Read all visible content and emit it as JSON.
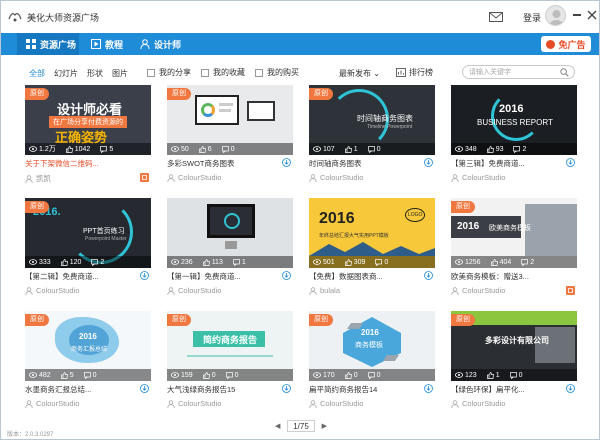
{
  "app": {
    "title": "美化大师资源广场",
    "login_label": "登录",
    "version": "版本：2.0.3.0297"
  },
  "nav": {
    "tabs": [
      {
        "label": "资源广场",
        "icon": "grid-icon"
      },
      {
        "label": "教程",
        "icon": "play-icon"
      },
      {
        "label": "设计师",
        "icon": "user-icon"
      }
    ],
    "ad_label": "免广告"
  },
  "filters": {
    "tabs": [
      "全部",
      "幻灯片",
      "形状",
      "图片"
    ],
    "checks": [
      "我的分享",
      "我的收藏",
      "我的购买"
    ],
    "sort_label": "最新发布 ⌄",
    "rank_label": "排行榜",
    "search_placeholder": "请输入关键字"
  },
  "cards": [
    {
      "title": "关于下架微信二维码...",
      "author": "凯凯",
      "views": "1.2万",
      "likes": "1042",
      "comments": "5",
      "original": true,
      "promo": true
    },
    {
      "title": "多彩SWOT商务图表",
      "author": "ColourStudio",
      "views": "50",
      "likes": "6",
      "comments": "0",
      "original": true,
      "promo": false
    },
    {
      "title": "时间轴商务图表",
      "author": "ColourStudio",
      "views": "107",
      "likes": "1",
      "comments": "0",
      "original": true,
      "promo": false
    },
    {
      "title": "【第三辑】免费商道...",
      "author": "ColourStudio",
      "views": "348",
      "likes": "93",
      "comments": "2",
      "original": false,
      "promo": false
    },
    {
      "title": "【第二辑】免费商道...",
      "author": "ColourStudio",
      "views": "333",
      "likes": "120",
      "comments": "2",
      "original": true,
      "promo": false
    },
    {
      "title": "【第一辑】免费商道...",
      "author": "ColourStudio",
      "views": "236",
      "likes": "113",
      "comments": "1",
      "original": false,
      "promo": false
    },
    {
      "title": "【免费】数据图表商...",
      "author": "bulala",
      "views": "501",
      "likes": "309",
      "comments": "0",
      "original": false,
      "promo": false
    },
    {
      "title": "欧美商务模板：赠送3...",
      "author": "ColourStudio",
      "views": "1256",
      "likes": "404",
      "comments": "2",
      "original": true,
      "promo": false
    },
    {
      "title": "水墨商务汇报总结...",
      "author": "ColourStudio",
      "views": "482",
      "likes": "5",
      "comments": "0",
      "original": true,
      "promo": false
    },
    {
      "title": "大气浅绿商务报告15",
      "author": "ColourStudio",
      "views": "159",
      "likes": "0",
      "comments": "0",
      "original": true,
      "promo": false
    },
    {
      "title": "扁平简约商务报告14",
      "author": "ColourStudio",
      "views": "170",
      "likes": "0",
      "comments": "0",
      "original": true,
      "promo": false
    },
    {
      "title": "【绿色环保】扁平化...",
      "author": "ColourStudio",
      "views": "123",
      "likes": "1",
      "comments": "0",
      "original": true,
      "promo": false
    }
  ],
  "thumb_text": {
    "c0_line1": "设计师必看",
    "c0_line2": "在广场分享付费资源的",
    "c0_line3": "正确姿势",
    "c2_line1": "时间轴商务图表",
    "c2_line2": "Timeline Powerpoint",
    "c3_line1": "2016",
    "c3_line2": "BUSINESS REPORT",
    "c4_line1": "2016.",
    "c4_line2": "PPT首页练习",
    "c4_line3": "Powerpoint Master",
    "c6_line1": "2016",
    "c6_line2": "LOGO",
    "c6_line3": "年终总结汇报大气实用PPT模板",
    "c7_line1": "2016",
    "c7_line2": "欧美商务模板",
    "c8_line1": "2016",
    "c8_line2": "商务汇报总结",
    "c9_line1": "简约商务报告",
    "c10_line1": "2016",
    "c10_line2": "商务模板",
    "c11_line1": "多彩设计有限公司"
  },
  "badge_label": "原创",
  "pager": {
    "prev": "◀",
    "current": "1/75",
    "next": "▶"
  },
  "colors": {
    "accent": "#1f8cd8",
    "original_badge": "#f07840",
    "promo_text": "#e84c27"
  }
}
